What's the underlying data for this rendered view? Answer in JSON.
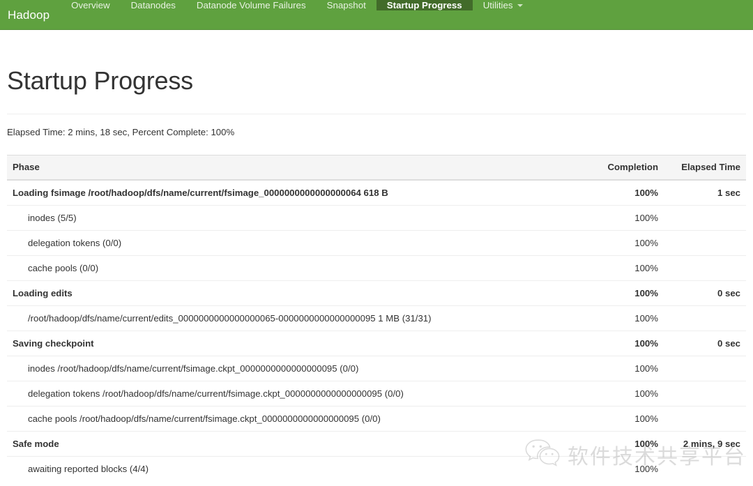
{
  "navbar": {
    "brand": "Hadoop",
    "items": [
      {
        "label": "Overview",
        "active": false,
        "dropdown": false
      },
      {
        "label": "Datanodes",
        "active": false,
        "dropdown": false
      },
      {
        "label": "Datanode Volume Failures",
        "active": false,
        "dropdown": false
      },
      {
        "label": "Snapshot",
        "active": false,
        "dropdown": false
      },
      {
        "label": "Startup Progress",
        "active": true,
        "dropdown": false
      },
      {
        "label": "Utilities",
        "active": false,
        "dropdown": true
      }
    ],
    "background_color": "#5fa13f",
    "active_color": "#426b2a"
  },
  "page": {
    "title": "Startup Progress",
    "summary": "Elapsed Time: 2 mins, 18 sec, Percent Complete: 100%"
  },
  "table": {
    "headers": {
      "phase": "Phase",
      "completion": "Completion",
      "elapsed": "Elapsed Time"
    },
    "rows": [
      {
        "type": "phase",
        "phase": "Loading fsimage /root/hadoop/dfs/name/current/fsimage_0000000000000000064 618 B",
        "completion": "100%",
        "elapsed": "1 sec"
      },
      {
        "type": "step",
        "phase": "inodes (5/5)",
        "completion": "100%",
        "elapsed": ""
      },
      {
        "type": "step",
        "phase": "delegation tokens (0/0)",
        "completion": "100%",
        "elapsed": ""
      },
      {
        "type": "step",
        "phase": "cache pools (0/0)",
        "completion": "100%",
        "elapsed": ""
      },
      {
        "type": "phase",
        "phase": "Loading edits",
        "completion": "100%",
        "elapsed": "0 sec"
      },
      {
        "type": "step",
        "phase": "/root/hadoop/dfs/name/current/edits_0000000000000000065-0000000000000000095 1 MB (31/31)",
        "completion": "100%",
        "elapsed": ""
      },
      {
        "type": "phase",
        "phase": "Saving checkpoint",
        "completion": "100%",
        "elapsed": "0 sec"
      },
      {
        "type": "step",
        "phase": "inodes /root/hadoop/dfs/name/current/fsimage.ckpt_0000000000000000095 (0/0)",
        "completion": "100%",
        "elapsed": ""
      },
      {
        "type": "step",
        "phase": "delegation tokens /root/hadoop/dfs/name/current/fsimage.ckpt_0000000000000000095 (0/0)",
        "completion": "100%",
        "elapsed": ""
      },
      {
        "type": "step",
        "phase": "cache pools /root/hadoop/dfs/name/current/fsimage.ckpt_0000000000000000095 (0/0)",
        "completion": "100%",
        "elapsed": ""
      },
      {
        "type": "phase",
        "phase": "Safe mode",
        "completion": "100%",
        "elapsed": "2 mins, 9 sec"
      },
      {
        "type": "step",
        "phase": "awaiting reported blocks (4/4)",
        "completion": "100%",
        "elapsed": ""
      }
    ]
  },
  "watermark": {
    "text": "软件技术共享平台",
    "icon": "wechat-icon"
  }
}
